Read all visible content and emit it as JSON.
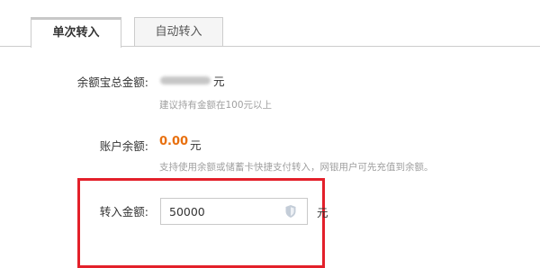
{
  "tabs": [
    {
      "label": "单次转入",
      "active": true
    },
    {
      "label": "自动转入",
      "active": false
    }
  ],
  "form": {
    "total_balance": {
      "label": "余额宝总金额:",
      "unit": "元",
      "hint": "建议持有金额在100元以上"
    },
    "account_balance": {
      "label": "账户余额:",
      "value": "0.00",
      "unit": "元",
      "hint": "支持使用余额或储蓄卡快捷支付转入，网银用户可先充值到余额。"
    },
    "transfer_amount": {
      "label": "转入金额:",
      "value": "50000",
      "unit": "元"
    }
  },
  "colors": {
    "accent_balance": "#e8700f",
    "highlight_border": "#e3202a"
  },
  "icons": {
    "input_icon": "shield-icon"
  }
}
